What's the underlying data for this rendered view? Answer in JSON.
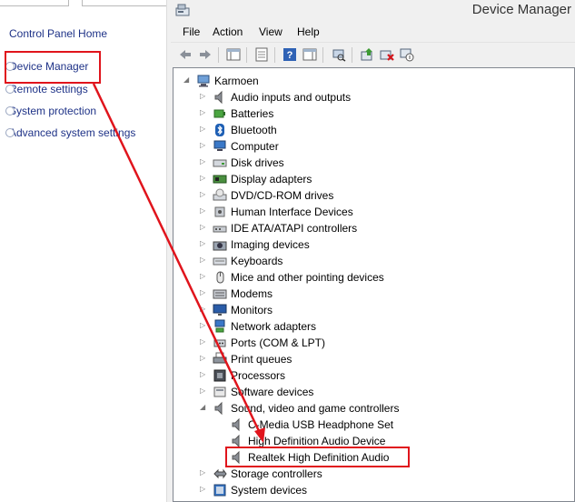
{
  "left_pane": {
    "home_link": "Control Panel Home",
    "links": [
      "Device Manager",
      "Remote settings",
      "System protection",
      "Advanced system settings"
    ]
  },
  "window": {
    "title": "Device Manager",
    "menu": [
      "File",
      "Action",
      "View",
      "Help"
    ],
    "toolbar_icons": [
      "back-arrow-icon",
      "forward-arrow-icon",
      "show-hide-console-tree-icon",
      "properties-icon",
      "help-icon",
      "action-pane-icon",
      "scan-hardware-icon",
      "update-driver-icon",
      "uninstall-icon",
      "disable-device-icon"
    ]
  },
  "tree": {
    "root": "Karmoen",
    "categories": [
      {
        "label": "Audio inputs and outputs",
        "icon": "speaker-icon"
      },
      {
        "label": "Batteries",
        "icon": "battery-icon"
      },
      {
        "label": "Bluetooth",
        "icon": "bluetooth-icon"
      },
      {
        "label": "Computer",
        "icon": "computer-icon"
      },
      {
        "label": "Disk drives",
        "icon": "disk-drive-icon"
      },
      {
        "label": "Display adapters",
        "icon": "display-adapter-icon"
      },
      {
        "label": "DVD/CD-ROM drives",
        "icon": "dvd-drive-icon"
      },
      {
        "label": "Human Interface Devices",
        "icon": "hid-icon"
      },
      {
        "label": "IDE ATA/ATAPI controllers",
        "icon": "ide-controller-icon"
      },
      {
        "label": "Imaging devices",
        "icon": "camera-icon"
      },
      {
        "label": "Keyboards",
        "icon": "keyboard-icon"
      },
      {
        "label": "Mice and other pointing devices",
        "icon": "mouse-icon"
      },
      {
        "label": "Modems",
        "icon": "modem-icon"
      },
      {
        "label": "Monitors",
        "icon": "monitor-icon"
      },
      {
        "label": "Network adapters",
        "icon": "network-adapter-icon"
      },
      {
        "label": "Ports (COM & LPT)",
        "icon": "port-icon"
      },
      {
        "label": "Print queues",
        "icon": "printer-icon"
      },
      {
        "label": "Processors",
        "icon": "processor-icon"
      },
      {
        "label": "Software devices",
        "icon": "software-device-icon"
      },
      {
        "label": "Sound, video and game controllers",
        "icon": "speaker-icon",
        "expanded": true,
        "children": [
          "C-Media USB Headphone Set",
          "High Definition Audio Device",
          "Realtek High Definition Audio"
        ]
      },
      {
        "label": "Storage controllers",
        "icon": "storage-controller-icon"
      },
      {
        "label": "System devices",
        "icon": "system-device-icon"
      }
    ]
  },
  "annotations": {
    "color": "#e0141c",
    "highlighted": [
      "Device Manager",
      "Realtek High Definition Audio"
    ]
  }
}
